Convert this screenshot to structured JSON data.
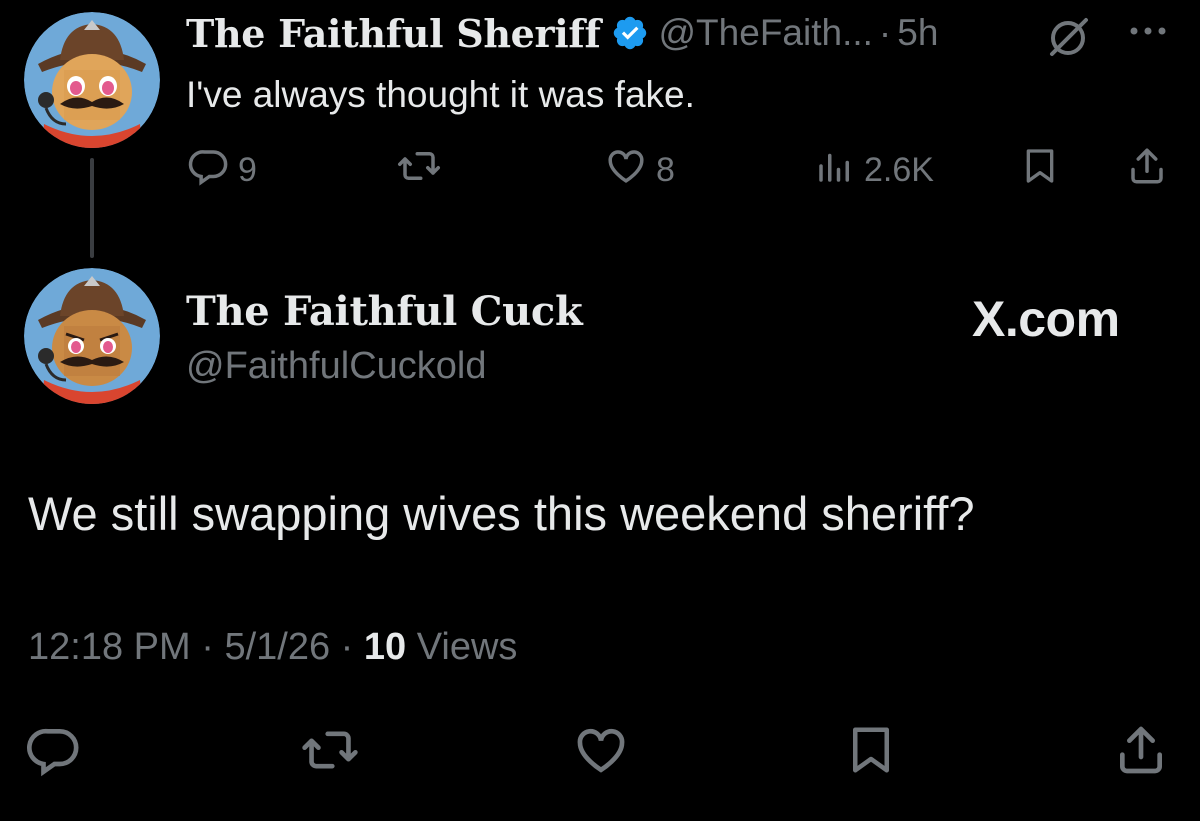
{
  "reply": {
    "display_name": "The Faithful Sheriff",
    "handle": "@TheFaith...",
    "separator": "·",
    "time": "5h",
    "text": "I've always thought it was fake.",
    "actions": {
      "replies": "9",
      "retweets": "",
      "likes": "8",
      "views": "2.6K"
    }
  },
  "main": {
    "display_name": "The Faithful Cuck",
    "handle": "@FaithfulCuckold",
    "watermark": "X.com",
    "text": "We still swapping wives this weekend sheriff?",
    "time": "12:18 PM",
    "date": "5/1/26",
    "separator": "·",
    "views_count": "10",
    "views_label": "Views"
  },
  "colors": {
    "background": "#000000",
    "text": "#e7e9ea",
    "muted": "#71767b",
    "verified": "#1d9bf0"
  },
  "icons": [
    "verified-badge-icon",
    "grok-icon",
    "more-icon",
    "reply-icon",
    "retweet-icon",
    "like-icon",
    "analytics-icon",
    "bookmark-icon",
    "share-icon"
  ]
}
